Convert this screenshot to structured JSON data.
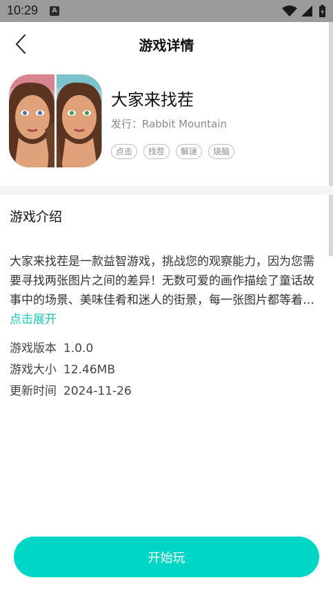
{
  "status_bar": {
    "time": "10:29",
    "notif_icon": "A"
  },
  "header": {
    "title": "游戏详情"
  },
  "game": {
    "name": "大家来找茬",
    "publisher": "发行：Rabbit Mountain",
    "tags": [
      "点击",
      "找茬",
      "解谜",
      "烧脑"
    ]
  },
  "intro": {
    "title": "游戏介绍",
    "text": "大家来找茬是一款益智游戏，挑战您的观察能力，因为您需要寻找两张图片之间的差异！无数可爱的画作描绘了童话故事中的场景、美味佳肴和迷人的街景，每一张图片都等着你去发现其中的不同之处。",
    "expand_label": "点击展开"
  },
  "info": [
    {
      "label": "游戏版本",
      "value": "1.0.0"
    },
    {
      "label": "游戏大小",
      "value": "12.46MB"
    },
    {
      "label": "更新时间",
      "value": "2024-11-26"
    }
  ],
  "play_button": {
    "label": "开始玩"
  },
  "colors": {
    "accent": "#00d6c6",
    "link": "#1ec7b8",
    "statusbar": "#9b9b9b"
  }
}
